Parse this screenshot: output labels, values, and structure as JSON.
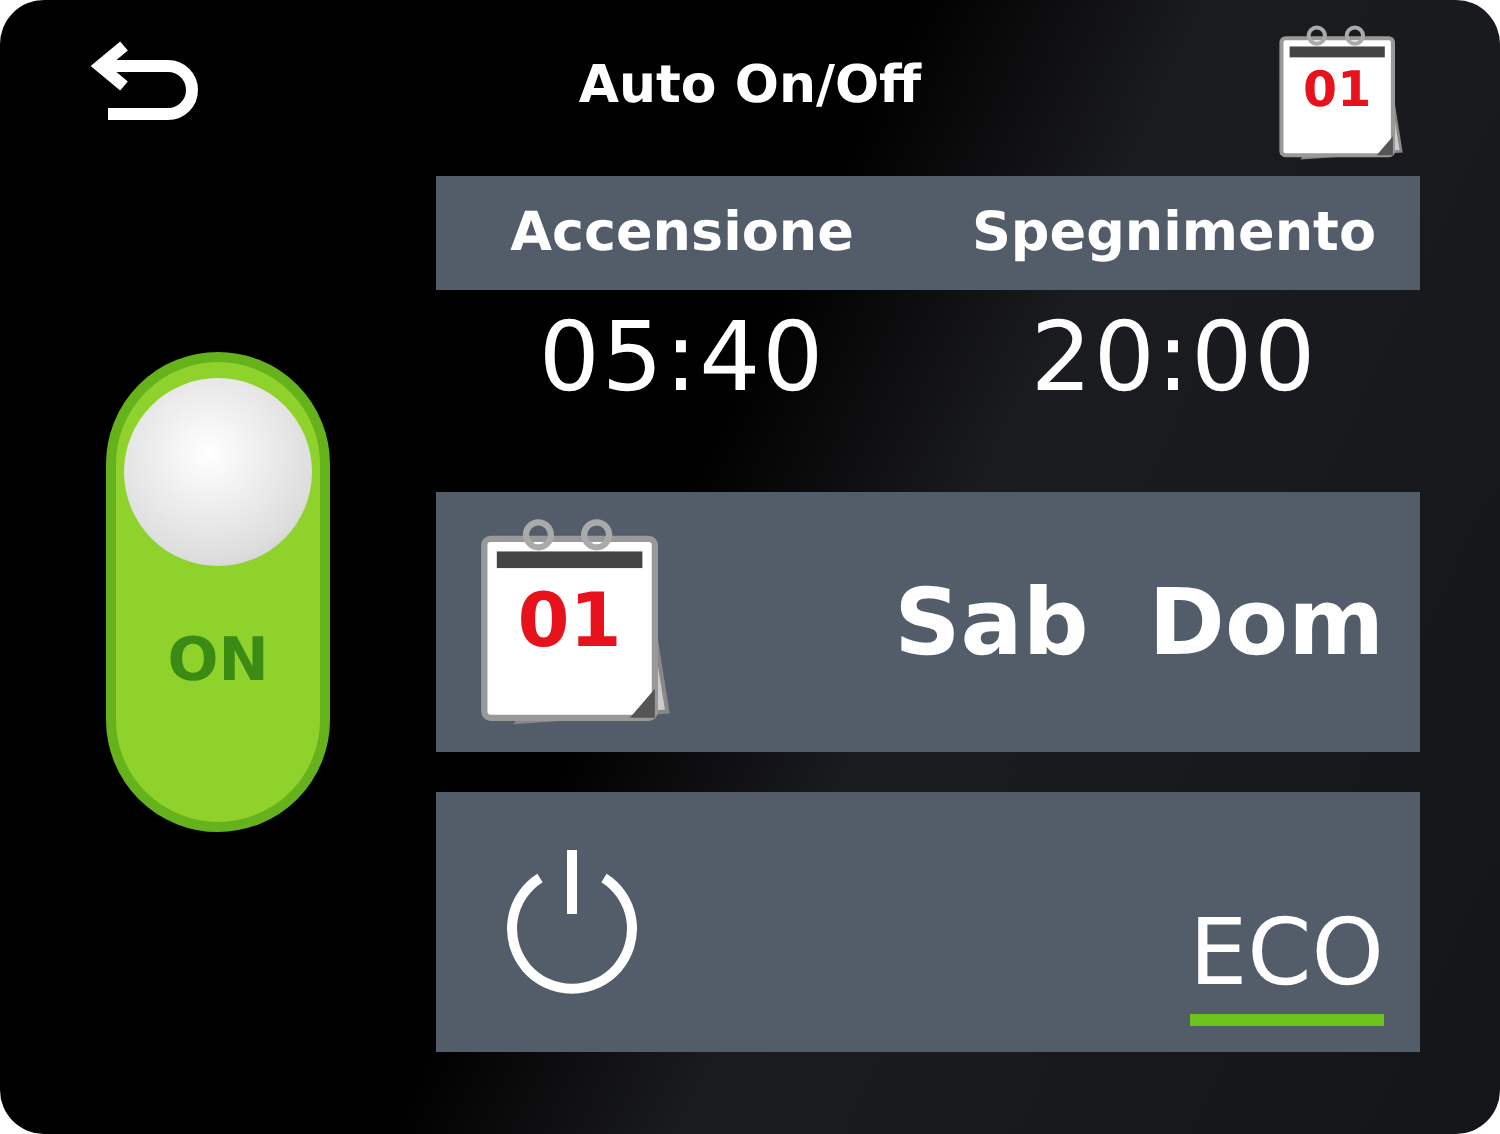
{
  "header": {
    "title": "Auto On/Off",
    "calendar_day": "01"
  },
  "toggle": {
    "on": true,
    "label": "ON"
  },
  "schedule": {
    "columns": [
      "Accensione",
      "Spegnimento"
    ],
    "times": [
      "05:40",
      "20:00"
    ]
  },
  "days": {
    "calendar_day": "01",
    "labels": [
      "Sab",
      "Dom"
    ]
  },
  "mode": {
    "label": "ECO",
    "selected": true
  }
}
